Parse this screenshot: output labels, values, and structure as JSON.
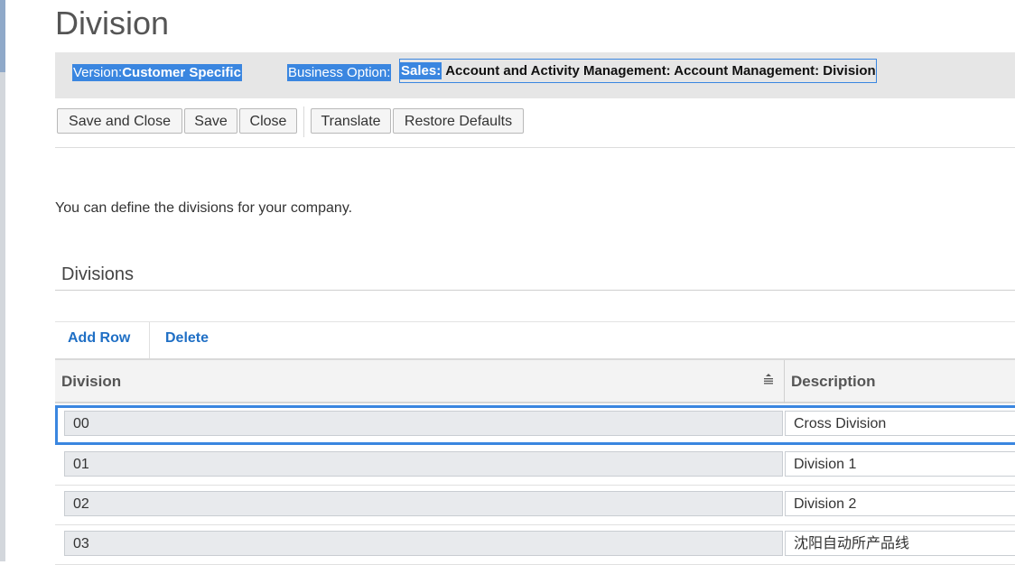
{
  "page": {
    "title": "Division"
  },
  "info_bar": {
    "version_label": "Version:",
    "version_value": "Customer Specific",
    "business_option_label": "Business Option:",
    "business_option_highlight": "Sales:",
    "business_option_rest": "Account and Activity Management: Account Management: Division",
    "highlight_color": "#3a86e0"
  },
  "toolbar": {
    "save_and_close": "Save and Close",
    "save": "Save",
    "close": "Close",
    "translate": "Translate",
    "restore_defaults": "Restore Defaults"
  },
  "intro_text": "You can define the divisions for your company.",
  "section": {
    "title": "Divisions",
    "add_row": "Add Row",
    "delete": "Delete",
    "link_color": "#1f6fc5"
  },
  "table": {
    "columns": [
      "Division",
      "Description"
    ],
    "sort_icon": "sort-ascending-icon",
    "rows": [
      {
        "division": "00",
        "description": "Cross Division",
        "selected": true
      },
      {
        "division": "01",
        "description": "Division 1",
        "selected": false
      },
      {
        "division": "02",
        "description": "Division 2",
        "selected": false
      },
      {
        "division": "03",
        "description": "沈阳自动所产品线",
        "selected": false
      }
    ]
  }
}
